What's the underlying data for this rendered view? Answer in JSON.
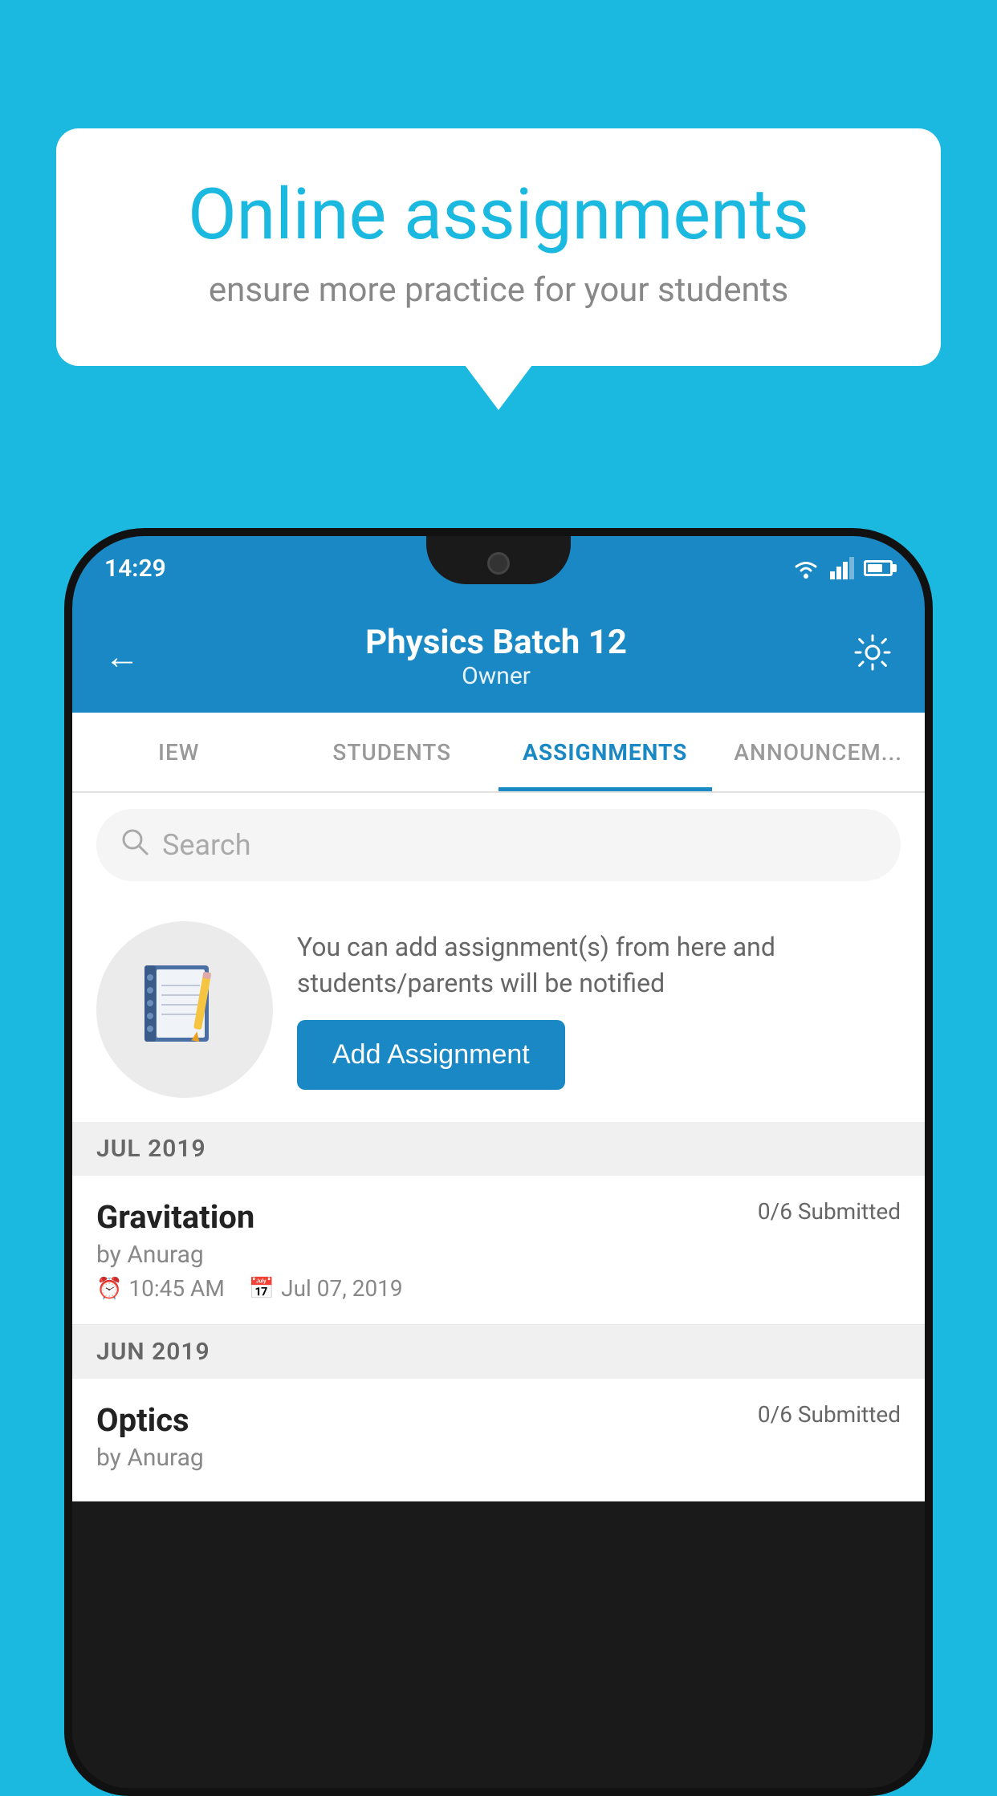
{
  "background_color": "#1BB8E0",
  "info_card": {
    "title": "Online assignments",
    "subtitle": "ensure more practice for your students"
  },
  "phone": {
    "status_bar": {
      "time": "14:29"
    },
    "header": {
      "title": "Physics Batch 12",
      "subtitle": "Owner",
      "back_button_label": "←",
      "settings_button_label": "⚙"
    },
    "tabs": [
      {
        "id": "view",
        "label": "IEW"
      },
      {
        "id": "students",
        "label": "STUDENTS"
      },
      {
        "id": "assignments",
        "label": "ASSIGNMENTS",
        "active": true
      },
      {
        "id": "announcements",
        "label": "ANNOUNCEM..."
      }
    ],
    "search": {
      "placeholder": "Search"
    },
    "add_assignment_card": {
      "description": "You can add assignment(s) from here and students/parents will be notified",
      "button_label": "Add Assignment"
    },
    "sections": [
      {
        "id": "jul2019",
        "label": "JUL 2019",
        "assignments": [
          {
            "id": "gravitation",
            "name": "Gravitation",
            "status": "0/6 Submitted",
            "author": "by Anurag",
            "time": "10:45 AM",
            "date": "Jul 07, 2019"
          }
        ]
      },
      {
        "id": "jun2019",
        "label": "JUN 2019",
        "assignments": [
          {
            "id": "optics",
            "name": "Optics",
            "status": "0/6 Submitted",
            "author": "by Anurag"
          }
        ]
      }
    ]
  }
}
